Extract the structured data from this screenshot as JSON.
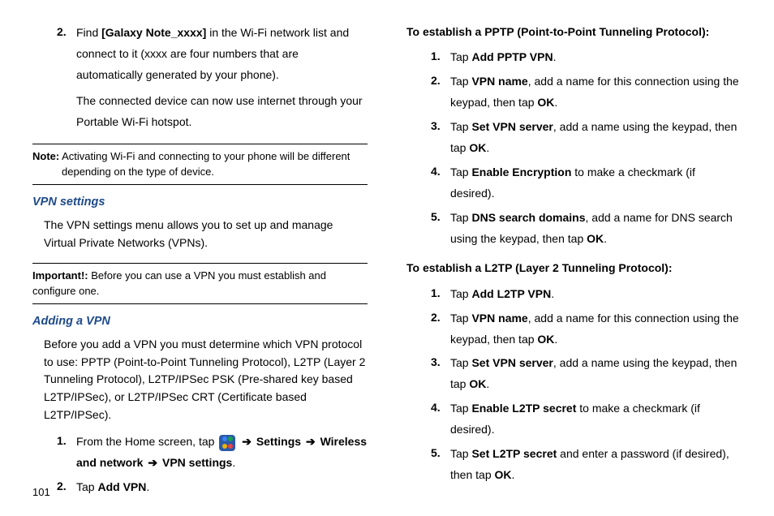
{
  "left": {
    "step2_num": "2.",
    "step2_p1a": "Find ",
    "step2_p1b": "[Galaxy Note_xxxx]",
    "step2_p1c": " in the Wi-Fi network list and connect to it (xxxx are four numbers that are automatically generated by your phone).",
    "step2_p2": "The connected device can now use internet through your Portable Wi-Fi hotspot.",
    "note_label": "Note:",
    "note_text": " Activating Wi-Fi and connecting to your phone will be different depending on the type of device.",
    "vpn_heading": "VPN settings",
    "vpn_body": "The VPN settings menu allows you to set up and manage Virtual Private Networks (VPNs).",
    "important_label": "Important!:",
    "important_text": " Before you can use a VPN you must establish and configure one.",
    "add_heading": "Adding a VPN",
    "add_body": "Before you add a VPN you must determine which VPN protocol to use: PPTP (Point-to-Point Tunneling Protocol), L2TP (Layer 2 Tunneling Protocol), L2TP/IPSec PSK (Pre-shared key based L2TP/IPSec), or L2TP/IPSec CRT (Certificate based L2TP/IPSec).",
    "s1_num": "1.",
    "s1_a": "From the Home screen, tap ",
    "s1_b": "Settings",
    "s1_c": "Wireless and network",
    "s1_d": "VPN settings",
    "s2_num": "2.",
    "s2_a": "Tap ",
    "s2_b": "Add VPN",
    "page": "101"
  },
  "right": {
    "pptp_heading": "To establish a PPTP (Point-to-Point Tunneling Protocol):",
    "p1_num": "1.",
    "p1_a": "Tap ",
    "p1_b": "Add PPTP VPN",
    "p1_c": ".",
    "p2_num": "2.",
    "p2_a": "Tap ",
    "p2_b": "VPN name",
    "p2_c": ", add a name for this connection using the keypad, then tap ",
    "p2_d": "OK",
    "p2_e": ".",
    "p3_num": "3.",
    "p3_a": "Tap ",
    "p3_b": "Set VPN server",
    "p3_c": ", add a name using the keypad, then tap ",
    "p3_d": "OK",
    "p3_e": ".",
    "p4_num": "4.",
    "p4_a": "Tap ",
    "p4_b": "Enable Encryption",
    "p4_c": " to make a checkmark (if desired).",
    "p5_num": "5.",
    "p5_a": "Tap ",
    "p5_b": "DNS search domains",
    "p5_c": ", add a name for DNS search using the keypad, then tap ",
    "p5_d": "OK",
    "p5_e": ".",
    "l2tp_heading": "To establish a L2TP (Layer 2 Tunneling Protocol):",
    "l1_num": "1.",
    "l1_a": "Tap ",
    "l1_b": "Add L2TP VPN",
    "l1_c": ".",
    "l2_num": "2.",
    "l2_a": "Tap ",
    "l2_b": "VPN name",
    "l2_c": ", add a name for this connection using the keypad, then tap ",
    "l2_d": "OK",
    "l2_e": ".",
    "l3_num": "3.",
    "l3_a": "Tap ",
    "l3_b": "Set VPN server",
    "l3_c": ", add a name using the keypad, then tap ",
    "l3_d": "OK",
    "l3_e": ".",
    "l4_num": "4.",
    "l4_a": "Tap ",
    "l4_b": "Enable L2TP secret",
    "l4_c": " to make a checkmark (if desired).",
    "l5_num": "5.",
    "l5_a": "Tap ",
    "l5_b": "Set L2TP secret",
    "l5_c": " and enter a password (if desired), then tap ",
    "l5_d": "OK",
    "l5_e": "."
  }
}
